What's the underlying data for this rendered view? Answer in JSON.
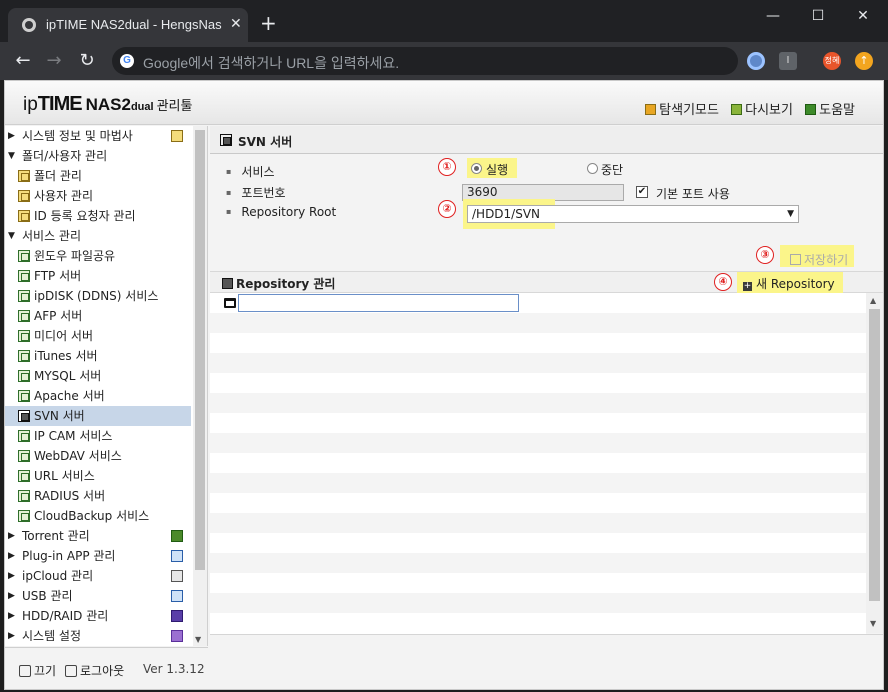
{
  "browser": {
    "tab_title": "ipTIME NAS2dual - HengsNas",
    "tab_close": "✕",
    "new_tab": "+",
    "window_controls": {
      "minimize": "—",
      "maximize": "☐",
      "close": "✕"
    },
    "nav": {
      "back": "←",
      "forward": "→",
      "reload": "↻"
    },
    "omnibox_placeholder": "Google에서 검색하거나 URL을 입력하세요.",
    "google_icon": "G",
    "profile_label": "정혜",
    "ext_label": "I"
  },
  "app": {
    "logo": {
      "ip": "ip",
      "time": "TIME",
      "model": "NAS2",
      "dual": "dual",
      "admin": "관리툴"
    },
    "header_links": {
      "explorer": "탐색기모드",
      "reload": "다시보기",
      "help": "도움말"
    },
    "sidebar": {
      "system": "시스템 정보 및 마법사",
      "folder_user": "폴더/사용자 관리",
      "folder_manage": "폴더 관리",
      "user_manage": "사용자 관리",
      "id_request": "ID 등록 요청자 관리",
      "service_manage": "서비스 관리",
      "windows_share": "윈도우 파일공유",
      "ftp": "FTP 서버",
      "ipdisk": "ipDISK (DDNS) 서비스",
      "afp": "AFP 서버",
      "media": "미디어 서버",
      "itunes": "iTunes 서버",
      "mysql": "MYSQL 서버",
      "apache": "Apache 서버",
      "svn": "SVN 서버",
      "ipcam": "IP CAM 서비스",
      "webdav": "WebDAV 서비스",
      "url": "URL 서비스",
      "radius": "RADIUS 서버",
      "cloudbackup": "CloudBackup 서비스",
      "torrent": "Torrent 관리",
      "plugin": "Plug-in APP 관리",
      "ipcloud": "ipCloud 관리",
      "usb": "USB 관리",
      "hdd": "HDD/RAID 관리",
      "system_setting": "시스템 설정"
    },
    "footer": {
      "power": "끄기",
      "logout": "로그아웃",
      "version": "Ver 1.3.12"
    },
    "page_title": "SVN 서버",
    "form": {
      "service_label": "서비스",
      "run_label": "실행",
      "stop_label": "중단",
      "service_value": "run",
      "port_label": "포트번호",
      "port_value": "3690",
      "default_port_label": "기본 포트 사용",
      "default_port_checked": true,
      "repo_root_label": "Repository Root",
      "repo_root_value": "/HDD1/SVN",
      "save_label": "저장하기"
    },
    "repo": {
      "title": "Repository 관리",
      "new_button": "새 Repository"
    },
    "markers": [
      "①",
      "②",
      "③",
      "④"
    ],
    "highlight_color": "#fbf58a",
    "marker_color": "#e02020"
  }
}
